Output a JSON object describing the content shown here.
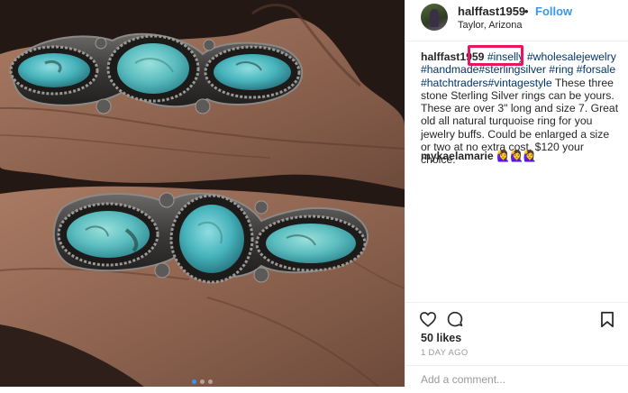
{
  "post": {
    "username": "halffast1959",
    "separator": "•",
    "follow_label": "Follow",
    "location": "Taylor, Arizona",
    "caption": {
      "username": "halffast1959",
      "hashtags_line1": [
        "#inselly",
        "#wholesalejewelry"
      ],
      "hashtags_line2": [
        "#handmade",
        "#sterlingsilver",
        "#ring",
        "#forsale"
      ],
      "hashtags_line3": [
        "#hatchtraders",
        "#vintagestyle"
      ],
      "text": " These three stone Sterling Silver rings can be yours. These are over 3\" long and size 7. Great old all natural turquoise ring for you jewelry buffs. Could be enlarged a size or two at no extra cost. $120 your choice."
    },
    "comment": {
      "username": "mykaelamarie",
      "emoji": "🙋‍♀️🙋‍♀️🙋‍♀️"
    },
    "likes": "50 likes",
    "time_ago": "1 DAY AGO",
    "add_comment_placeholder": "Add a comment...",
    "carousel": {
      "slides": 3,
      "active_index": 0
    },
    "highlight": {
      "target": "#inselly",
      "color": "#e8175d"
    },
    "icons": [
      "heart-icon",
      "comment-icon",
      "bookmark-icon"
    ]
  }
}
